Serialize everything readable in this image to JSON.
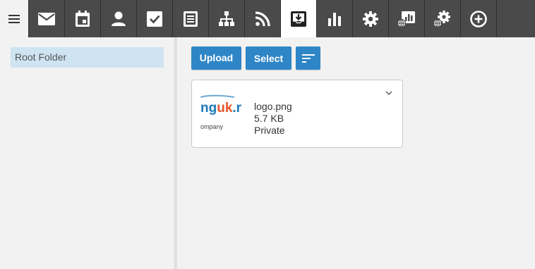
{
  "toolbar": {
    "items": [
      {
        "icon": "menu-icon"
      },
      {
        "icon": "mail-icon"
      },
      {
        "icon": "calendar-icon"
      },
      {
        "icon": "person-icon"
      },
      {
        "icon": "checkbox-icon"
      },
      {
        "icon": "document-list-icon"
      },
      {
        "icon": "sitemap-icon"
      },
      {
        "icon": "rss-icon"
      },
      {
        "icon": "inbox-download-icon",
        "active": true
      },
      {
        "icon": "bar-chart-icon"
      },
      {
        "icon": "gear-icon"
      },
      {
        "icon": "web-report-icon"
      },
      {
        "icon": "web-settings-icon"
      },
      {
        "icon": "add-circle-icon"
      }
    ]
  },
  "sidebar": {
    "folders": [
      {
        "label": "Root Folder",
        "selected": true
      }
    ]
  },
  "actions": {
    "upload_label": "Upload",
    "select_label": "Select",
    "sort_icon": "sort-icon"
  },
  "files": [
    {
      "thumbnail_text": "nguk.r",
      "thumbnail_subtext": "ompany",
      "name": "logo.png",
      "size": "5.7 KB",
      "visibility": "Private"
    }
  ],
  "colors": {
    "toolbar_bg": "#4a4a4a",
    "accent": "#2f86c6",
    "selected_folder_bg": "#cfe4f3",
    "logo_blue": "#1a7ab8",
    "logo_orange": "#e8562a"
  }
}
